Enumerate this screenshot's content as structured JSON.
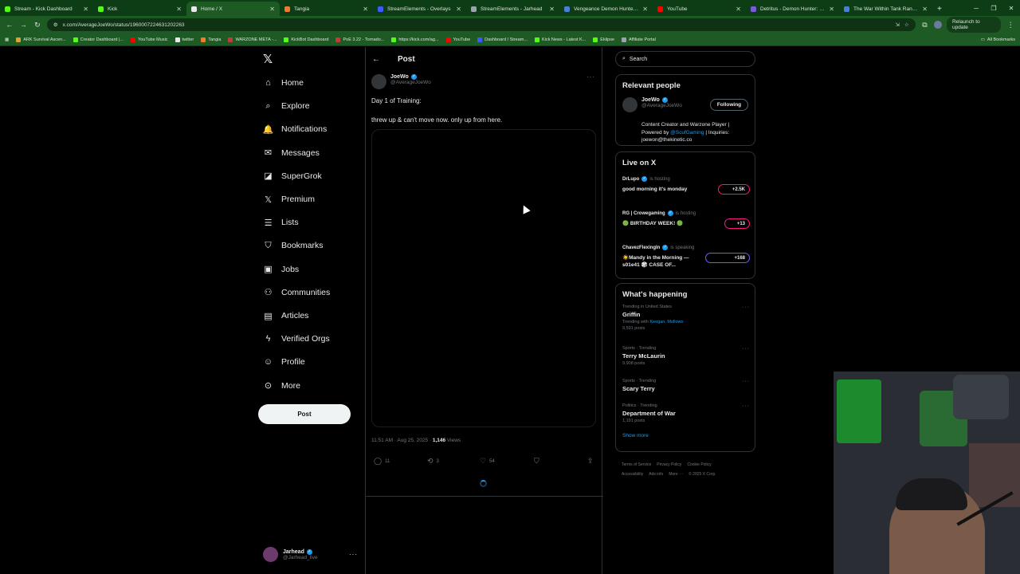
{
  "browser": {
    "tabs": [
      {
        "label": "Stream - Kick Dashboard",
        "color": "#53fc18",
        "active": false
      },
      {
        "label": "Kick",
        "color": "#53fc18",
        "active": false
      },
      {
        "label": "Home / X",
        "color": "#e7e9ea",
        "active": true
      },
      {
        "label": "Tangia",
        "color": "#f07a2e",
        "active": false
      },
      {
        "label": "StreamElements - Overlays",
        "color": "#3d5afe",
        "active": false
      },
      {
        "label": "StreamElements - Jarhead",
        "color": "#9aa4b0",
        "active": false
      },
      {
        "label": "Vengeance Demon Hunter Ta",
        "color": "#4a7fd6",
        "active": false
      },
      {
        "label": "YouTube",
        "color": "#ff0000",
        "active": false
      },
      {
        "label": "Detritus - Demon Hunter: Ven",
        "color": "#7a5cd6",
        "active": false
      },
      {
        "label": "The War Within Tank Ranking",
        "color": "#4a7fd6",
        "active": false
      }
    ],
    "url": "x.com/AverageJoeWo/status/1960007224631202263",
    "relaunch_label": "Relaunch to update",
    "bookmarks": [
      {
        "label": "ARK Survival Ascen...",
        "color": "#d6a23a"
      },
      {
        "label": "Creator Dashboard |...",
        "color": "#53fc18"
      },
      {
        "label": "YouTube Music",
        "color": "#ff0000"
      },
      {
        "label": "twitter",
        "color": "#e7e9ea"
      },
      {
        "label": "Tangia",
        "color": "#f07a2e"
      },
      {
        "label": "WARZONE META -...",
        "color": "#c23a3a"
      },
      {
        "label": "KickBot Dashboard",
        "color": "#53fc18"
      },
      {
        "label": "PoE 3.22 - Tornado...",
        "color": "#c23a3a"
      },
      {
        "label": "https://kick.com/ag...",
        "color": "#53fc18"
      },
      {
        "label": "YouTube",
        "color": "#ff0000"
      },
      {
        "label": "Dashboard / Stream...",
        "color": "#3d5afe"
      },
      {
        "label": "Kick News - Latest K...",
        "color": "#53fc18"
      },
      {
        "label": "Eklipse",
        "color": "#53fc18"
      },
      {
        "label": "Affiliate Portal",
        "color": "#9aa4b0"
      }
    ],
    "all_bookmarks": "All Bookmarks"
  },
  "nav": {
    "items": [
      {
        "label": "Home",
        "icon": "home-icon",
        "glyph": "⌂"
      },
      {
        "label": "Explore",
        "icon": "search-icon",
        "glyph": "⌕"
      },
      {
        "label": "Notifications",
        "icon": "bell-icon",
        "glyph": "🔔"
      },
      {
        "label": "Messages",
        "icon": "mail-icon",
        "glyph": "✉"
      },
      {
        "label": "SuperGrok",
        "icon": "grok-icon",
        "glyph": "◪"
      },
      {
        "label": "Premium",
        "icon": "x-premium-icon",
        "glyph": "𝕏"
      },
      {
        "label": "Lists",
        "icon": "list-icon",
        "glyph": "☰"
      },
      {
        "label": "Bookmarks",
        "icon": "bookmark-icon",
        "glyph": "⛉"
      },
      {
        "label": "Jobs",
        "icon": "briefcase-icon",
        "glyph": "▣"
      },
      {
        "label": "Communities",
        "icon": "people-icon",
        "glyph": "⚇"
      },
      {
        "label": "Articles",
        "icon": "article-icon",
        "glyph": "▤"
      },
      {
        "label": "Verified Orgs",
        "icon": "lightning-icon",
        "glyph": "ϟ"
      },
      {
        "label": "Profile",
        "icon": "person-icon",
        "glyph": "☺"
      },
      {
        "label": "More",
        "icon": "more-circle-icon",
        "glyph": "⊙"
      }
    ],
    "post_label": "Post",
    "account": {
      "name": "Jarhead",
      "handle": "@Jarhead_live"
    }
  },
  "post": {
    "header": "Post",
    "author_name": "JoeWo",
    "author_handle": "@AverageJoeWo",
    "text_line1": "Day 1 of Training:",
    "text_line2": "threw up & can't move now. only up from here.",
    "time": "11:51 AM · Aug 25, 2025 · ",
    "views_count": "1,146",
    "views_label": " Views",
    "replies": "11",
    "reposts": "3",
    "likes": "54"
  },
  "right": {
    "search_placeholder": "Search",
    "relevant": {
      "title": "Relevant people",
      "name": "JoeWo",
      "handle": "@AverageJoeWo",
      "follow_label": "Following",
      "bio_pre": "Content Creator and Warzone Player | Powered by ",
      "bio_link": "@ScufGaming",
      "bio_post": " | Inquiries: joewon@thekinetic.co"
    },
    "live": {
      "title": "Live on X",
      "items": [
        {
          "host": "DrLupo",
          "status": "is hosting",
          "title": "good morning it's monday",
          "count": "+2.5K",
          "color": "#f91880"
        },
        {
          "host": "RG | Crowegaming",
          "status": "is hosting",
          "title": "🟢 BIRTHDAY WEEK! 🟢",
          "count": "+13",
          "color": "#f91880"
        },
        {
          "host": "ChavezFlexingIn",
          "status": "is speaking",
          "title": "☀️Mandy in the Morning —s01e41 🎲 CASE OF...",
          "count": "+168",
          "color": "#7856ff"
        }
      ]
    },
    "happening": {
      "title": "What's happening",
      "trends": [
        {
          "context": "Trending in United States",
          "name": "Griffin",
          "with_pre": "Trending with ",
          "with_link": "Keegan, Mollowo",
          "posts": "9,591 posts"
        },
        {
          "context": "Sports · Trending",
          "name": "Terry McLaurin",
          "with_pre": "",
          "with_link": "",
          "posts": "9,908 posts"
        },
        {
          "context": "Sports · Trending",
          "name": "Scary Terry",
          "with_pre": "",
          "with_link": "",
          "posts": ""
        },
        {
          "context": "Politics · Trending",
          "name": "Department of War",
          "with_pre": "",
          "with_link": "",
          "posts": "1,191 posts"
        }
      ],
      "show_more": "Show more"
    },
    "footer": [
      "Terms of Service",
      "Privacy Policy",
      "Cookie Policy",
      "Accessibility",
      "Ads info",
      "More ···",
      "© 2025 X Corp."
    ]
  }
}
